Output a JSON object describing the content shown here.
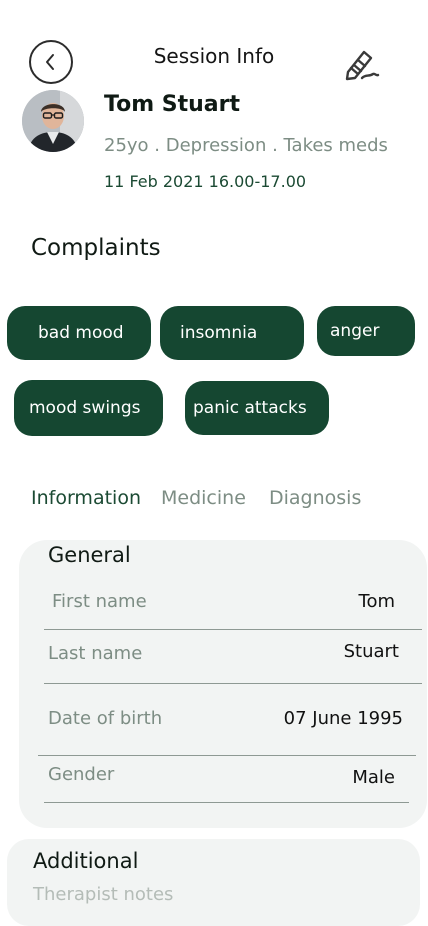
{
  "header": {
    "title": "Session Info",
    "back_icon": "chevron-left-icon",
    "edit_icon": "edit-pen-icon"
  },
  "patient": {
    "name": "Tom Stuart",
    "summary": "25yo . Depression . Takes meds",
    "session_datetime": "11 Feb 2021 16.00-17.00"
  },
  "complaints": {
    "title": "Complaints",
    "items": [
      "bad mood",
      "insomnia",
      "anger",
      "mood swings",
      "panic attacks"
    ]
  },
  "tabs": [
    {
      "label": "Information",
      "active": true
    },
    {
      "label": "Medicine",
      "active": false
    },
    {
      "label": "Diagnosis",
      "active": false
    }
  ],
  "general": {
    "heading": "General",
    "fields": [
      {
        "label": "First name",
        "value": "Tom"
      },
      {
        "label": "Last name",
        "value": "Stuart"
      },
      {
        "label": "Date of birth",
        "value": "07 June 1995"
      },
      {
        "label": "Gender",
        "value": "Male"
      }
    ]
  },
  "additional": {
    "heading": "Additional",
    "notes_placeholder": "Therapist  notes"
  },
  "colors": {
    "chip_bg": "#154731",
    "card_bg": "#f2f4f3",
    "muted_text": "#7d8d84",
    "accent": "#1b4a33"
  }
}
